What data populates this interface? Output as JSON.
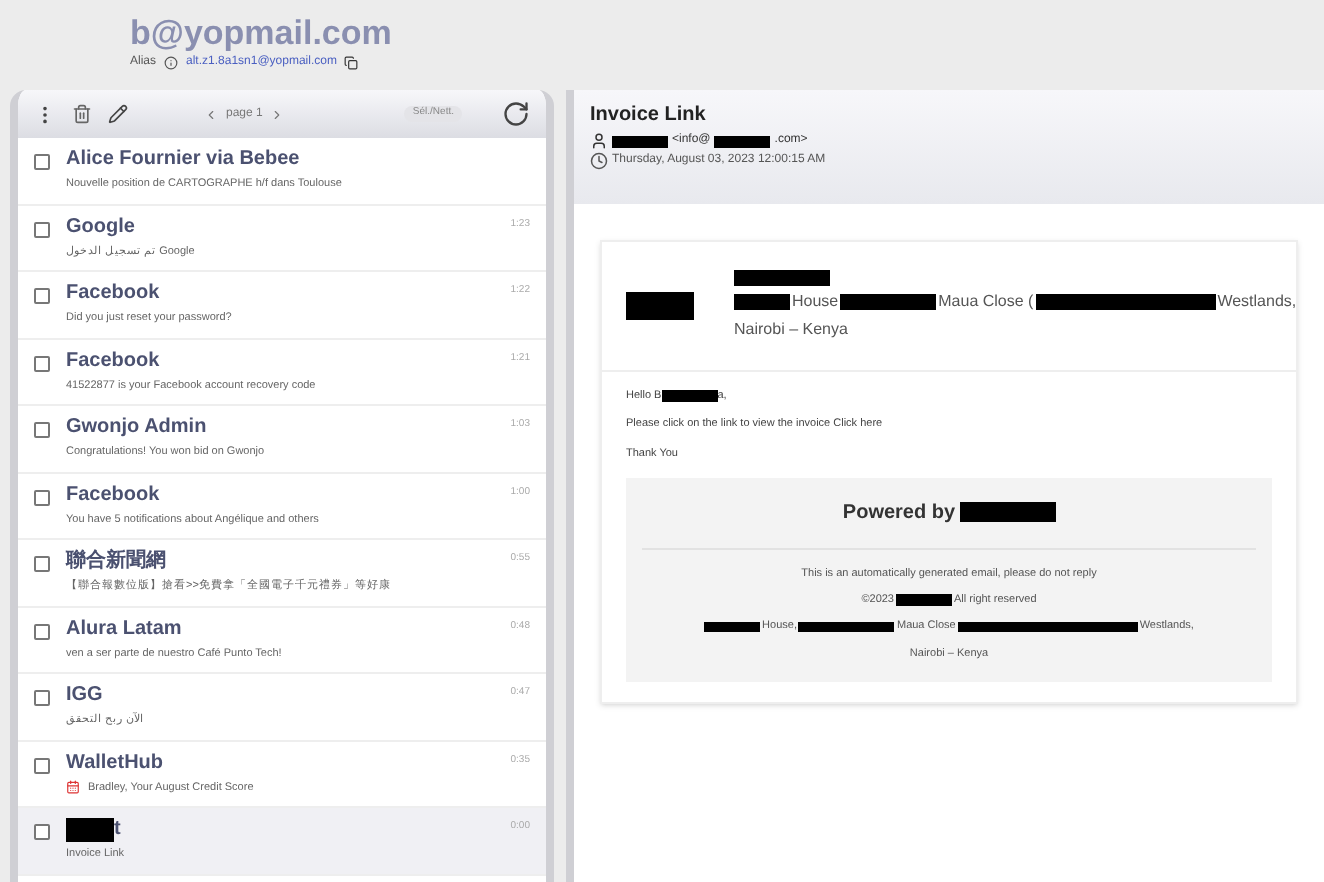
{
  "account": {
    "address": "b@yopmail.com",
    "alias_label": "Alias",
    "alias": "alt.z1.8a1sn1@yopmail.com"
  },
  "toolbar": {
    "pager": "page 1",
    "select_label": "Sél./Nett."
  },
  "messages": [
    {
      "from": "Alice Fournier via Bebee",
      "subject": "Nouvelle position de CARTOGRAPHE h/f dans Toulouse",
      "selected": false,
      "checked": false
    },
    {
      "from": "Google",
      "subject": "تم تسجيل الدخول Google",
      "time": "1:23",
      "selected": false,
      "checked": false
    },
    {
      "from": "Facebook",
      "subject": "Did you just reset your password?",
      "time": "1:22",
      "selected": false,
      "checked": false
    },
    {
      "from": "Facebook",
      "subject": "41522877 is your Facebook account recovery code",
      "time": "1:21",
      "selected": false,
      "checked": false
    },
    {
      "from": "Gwonjo Admin",
      "subject": "Congratulations! You won bid on Gwonjo",
      "time": "1:03",
      "selected": false,
      "checked": false
    },
    {
      "from": "Facebook",
      "subject": "You have 5 notifications about Angélique and others",
      "time": "1:00",
      "selected": false,
      "checked": false
    },
    {
      "from": "聯合新聞網",
      "subject": "【聯合報數位版】搶看>>免費拿「全國電子千元禮券」等好康",
      "time": "0:55",
      "selected": false,
      "checked": false
    },
    {
      "from": "Alura Latam",
      "subject": "ven a ser parte de nuestro Café Punto Tech!",
      "time": "0:48",
      "selected": false,
      "checked": false
    },
    {
      "from": "IGG",
      "subject": "الآن ربح التحقق",
      "time": "0:47",
      "selected": false,
      "checked": false
    },
    {
      "from": "WalletHub",
      "subject": "Bradley, Your August Credit Score",
      "time": "0:35",
      "selected": false,
      "checked": false,
      "calendar": true
    },
    {
      "from_redacted": true,
      "from": "t",
      "subject": "Invoice Link",
      "time": "0:00",
      "selected": true,
      "checked": false
    }
  ],
  "message": {
    "subject": "Invoice Link",
    "sender": [
      {
        "kind": "redacted-short"
      },
      {
        "kind": "text",
        "text": "<info@"
      },
      {
        "kind": "redacted-short"
      },
      {
        "kind": "text",
        "text": ".com>"
      }
    ],
    "date": "Thursday, August 03, 2023 12:00:15 AM",
    "header_lines": [
      [
        {
          "kind": "redacted-medium"
        }
      ],
      [
        {
          "kind": "redacted-short"
        },
        {
          "kind": "text",
          "text": "House"
        },
        {
          "kind": "redacted-medium"
        },
        {
          "kind": "text",
          "text": "Maua Close ("
        },
        {
          "kind": "redacted-long"
        },
        {
          "kind": "text",
          "text": "Westlands,"
        }
      ],
      [
        {
          "kind": "text",
          "text": "Nairobi – Kenya"
        }
      ]
    ],
    "body_lines": [
      [
        {
          "kind": "text",
          "text": "Hello B"
        },
        {
          "kind": "redacted-short"
        },
        {
          "kind": "text",
          "text": "a,"
        }
      ],
      [
        {
          "kind": "text",
          "text": "Please click on the link to view the invoice Click here"
        }
      ],
      [
        {
          "kind": "text",
          "text": "Thank You"
        }
      ]
    ],
    "powered": [
      {
        "kind": "text",
        "text": "Powered by"
      },
      {
        "kind": "redacted-medium"
      }
    ],
    "footer_lines": [
      [
        {
          "kind": "text",
          "text": "This is an automatically generated email, please do not reply"
        }
      ],
      [
        {
          "kind": "text",
          "text": "©2023"
        },
        {
          "kind": "redacted-short"
        },
        {
          "kind": "text",
          "text": "All right reserved"
        }
      ],
      [
        {
          "kind": "redacted-short"
        },
        {
          "kind": "text",
          "text": "House,"
        },
        {
          "kind": "redacted-medium"
        },
        {
          "kind": "text",
          "text": "Maua Close"
        },
        {
          "kind": "redacted-long"
        },
        {
          "kind": "text",
          "text": "Westlands,"
        }
      ],
      [
        {
          "kind": "text",
          "text": "Nairobi – Kenya"
        }
      ]
    ]
  }
}
